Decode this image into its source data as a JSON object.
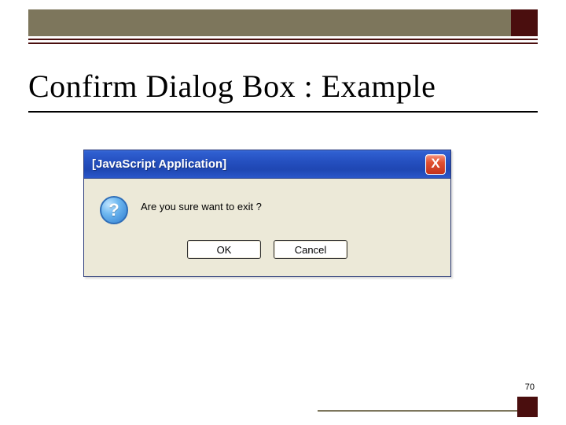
{
  "slide": {
    "title": "Confirm Dialog Box : Example",
    "page_number": "70"
  },
  "dialog": {
    "title": "[JavaScript Application]",
    "close_label": "X",
    "question_glyph": "?",
    "message": "Are you sure want to exit ?",
    "ok_label": "OK",
    "cancel_label": "Cancel"
  }
}
